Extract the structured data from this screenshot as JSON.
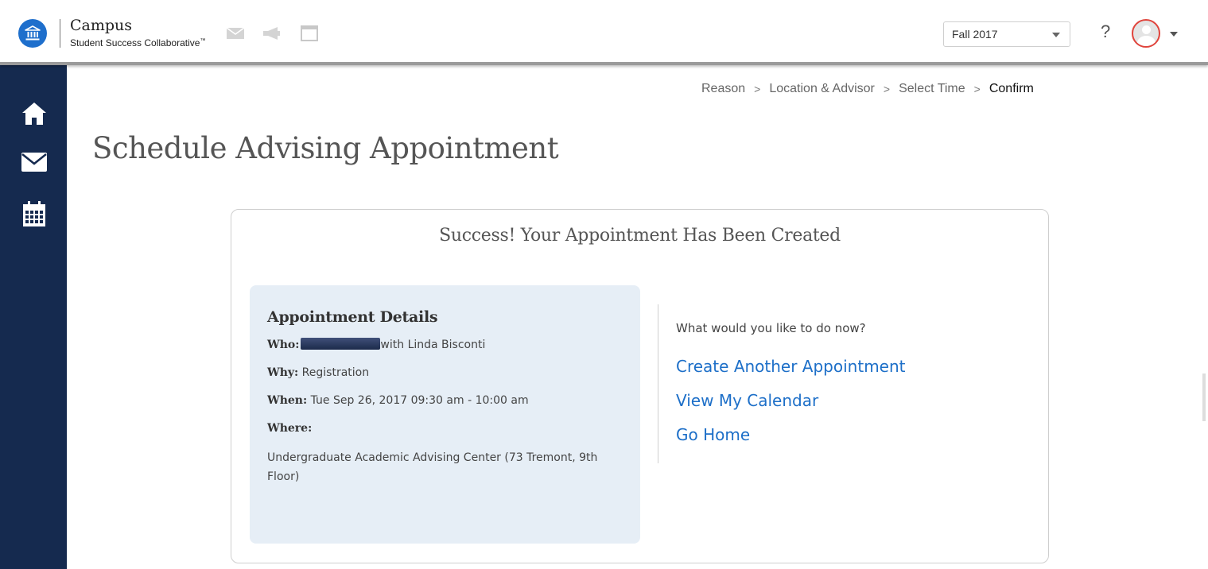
{
  "brand": {
    "title": "Campus",
    "subtitle": "Student Success Collaborative",
    "trademark": "™"
  },
  "header": {
    "term_value": "Fall 2017",
    "help_label": "?"
  },
  "breadcrumb": {
    "steps": [
      "Reason",
      "Location & Advisor",
      "Select Time",
      "Confirm"
    ],
    "separator": ">"
  },
  "page": {
    "title": "Schedule Advising Appointment"
  },
  "card": {
    "title": "Success! Your Appointment Has Been Created",
    "details": {
      "heading": "Appointment Details",
      "who_label": "Who:",
      "who_value": "with Linda Bisconti",
      "why_label": "Why:",
      "why_value": "Registration",
      "when_label": "When:",
      "when_value": "Tue Sep 26, 2017 09:30 am - 10:00 am",
      "where_label": "Where:",
      "where_value": "Undergraduate Academic Advising Center (73 Tremont, 9th Floor)"
    },
    "actions": {
      "prompt": "What would you like to do now?",
      "create_another": "Create Another Appointment",
      "view_calendar": "View My Calendar",
      "go_home": "Go Home"
    }
  },
  "colors": {
    "sidebar": "#152a4f",
    "link": "#1d6fc8",
    "logo": "#1e6fcc",
    "details_bg": "#e6eef6",
    "avatar_ring": "#e0443c"
  },
  "icons": {
    "logo": "institution-icon",
    "header": [
      "mail-icon",
      "megaphone-icon",
      "window-icon"
    ],
    "sidebar": [
      "home-icon",
      "envelope-icon",
      "calendar-icon"
    ]
  }
}
